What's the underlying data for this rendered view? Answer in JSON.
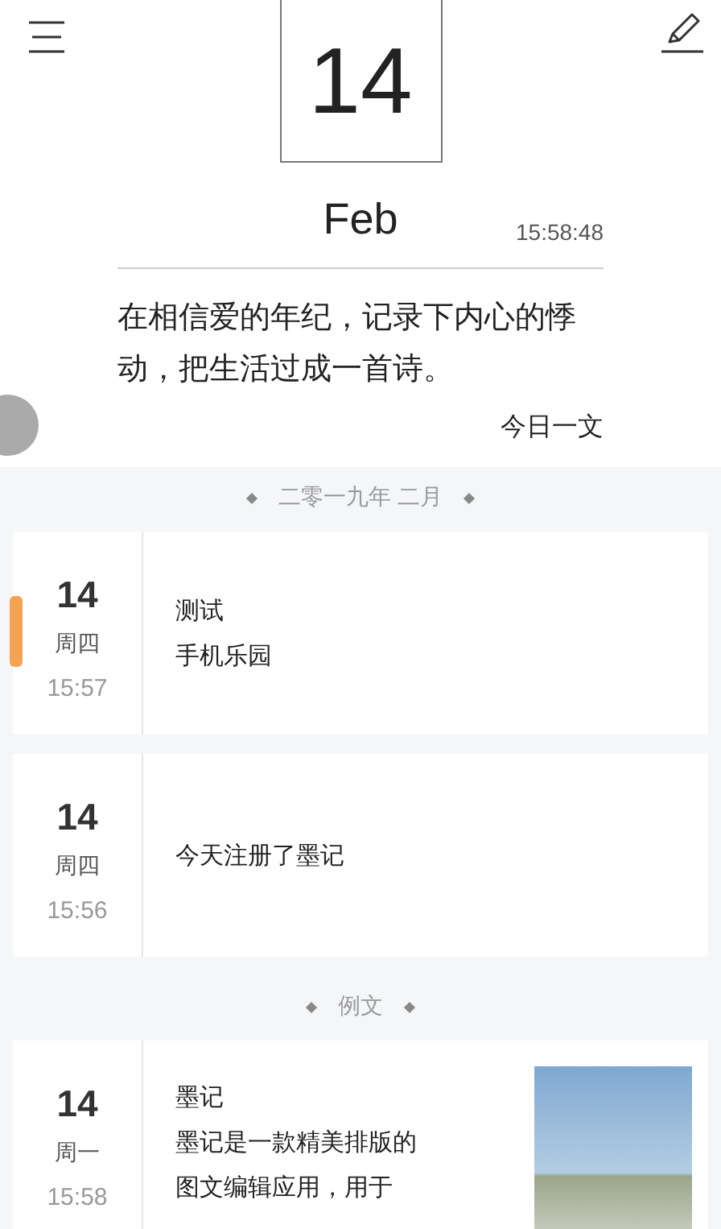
{
  "header": {
    "day": "14",
    "month": "Feb",
    "time": "15:58:48",
    "quote": "在相信爱的年纪，记录下内心的悸动，把生活过成一首诗。",
    "quote_label": "今日一文"
  },
  "sections": [
    {
      "label": "二零一九年 二月",
      "entries": [
        {
          "day": "14",
          "weekday": "周四",
          "time": "15:57",
          "lines": [
            "测试",
            "手机乐园"
          ],
          "marked": true,
          "photo": false
        },
        {
          "day": "14",
          "weekday": "周四",
          "time": "15:56",
          "lines": [
            "今天注册了墨记"
          ],
          "marked": false,
          "photo": false
        }
      ]
    },
    {
      "label": "例文",
      "entries": [
        {
          "day": "14",
          "weekday": "周一",
          "time": "15:58",
          "lines": [
            "墨记",
            "墨记是一款精美排版的",
            "图文编辑应用，用于"
          ],
          "marked": false,
          "photo": true
        }
      ]
    }
  ]
}
